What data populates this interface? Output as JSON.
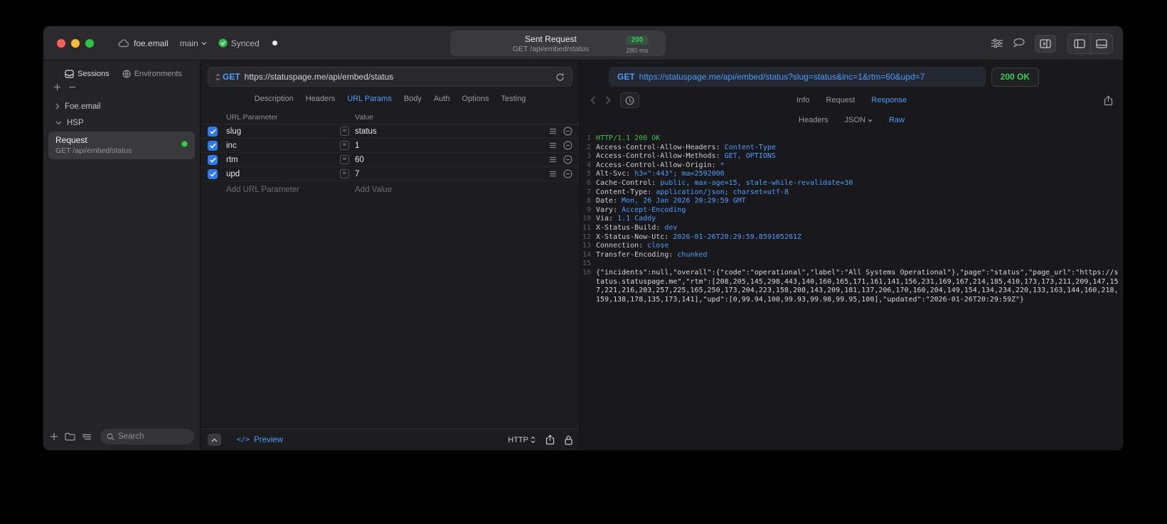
{
  "window": {
    "account": "foe.email",
    "branch": "main",
    "sync_status": "Synced",
    "request_title": "Sent Request",
    "request_subtitle": "GET /api/embed/status",
    "status_code": "200",
    "duration": "280 ms",
    "accent_blue": "#4a9eff",
    "status_green": "#30d158"
  },
  "sidebar": {
    "tabs": [
      {
        "label": "Sessions"
      },
      {
        "label": "Environments"
      }
    ],
    "tree": [
      {
        "label": "Foe.email"
      },
      {
        "label": "HSP"
      }
    ],
    "request_item": {
      "title": "Request",
      "subtitle": "GET /api/embed/status"
    },
    "search_placeholder": "Search"
  },
  "request_panel": {
    "method": "GET",
    "url": "https://statuspage.me/api/embed/status",
    "tabs": [
      "Description",
      "Headers",
      "URL Params",
      "Body",
      "Auth",
      "Options",
      "Testing"
    ],
    "active_tab": "URL Params",
    "table": {
      "col_param": "URL Parameter",
      "col_value": "Value",
      "rows": [
        {
          "name": "slug",
          "value": "status",
          "checked": true
        },
        {
          "name": "inc",
          "value": "1",
          "checked": true
        },
        {
          "name": "rtm",
          "value": "60",
          "checked": true
        },
        {
          "name": "upd",
          "value": "7",
          "checked": true
        }
      ],
      "add_param": "Add URL Parameter",
      "add_value": "Add Value"
    },
    "footer": {
      "preview_label": "Preview",
      "http_label": "HTTP"
    }
  },
  "response_panel": {
    "method": "GET",
    "url": "https://statuspage.me/api/embed/status?slug=status&inc=1&rtm=60&upd=7",
    "status": "200 OK",
    "tabs": [
      "Info",
      "Request",
      "Response"
    ],
    "active_tab": "Response",
    "subtabs": [
      "Headers",
      "JSON",
      "Raw"
    ],
    "active_subtab": "Raw",
    "lines": [
      {
        "n": "1",
        "text": "HTTP/1.1 200 OK"
      },
      {
        "n": "2",
        "name": "Access-Control-Allow-Headers:",
        "value": "Content-Type"
      },
      {
        "n": "3",
        "name": "Access-Control-Allow-Methods:",
        "value": "GET, OPTIONS"
      },
      {
        "n": "4",
        "name": "Access-Control-Allow-Origin:",
        "value": "*"
      },
      {
        "n": "5",
        "name": "Alt-Svc:",
        "value": "h3=\":443\"; ma=2592000"
      },
      {
        "n": "6",
        "name": "Cache-Control:",
        "value": "public, max-age=15, stale-while-revalidate=30"
      },
      {
        "n": "7",
        "name": "Content-Type:",
        "value": "application/json; charset=utf-8"
      },
      {
        "n": "8",
        "name": "Date:",
        "value": "Mon, 26 Jan 2026 20:29:59 GMT"
      },
      {
        "n": "9",
        "name": "Vary:",
        "value": "Accept-Encoding"
      },
      {
        "n": "10",
        "name": "Via:",
        "value": "1.1 Caddy"
      },
      {
        "n": "11",
        "name": "X-Status-Build:",
        "value": "dev"
      },
      {
        "n": "12",
        "name": "X-Status-Now-Utc:",
        "value": "2026-01-26T20:29:59.859105261Z"
      },
      {
        "n": "13",
        "name": "Connection:",
        "value": "close"
      },
      {
        "n": "14",
        "name": "Transfer-Encoding:",
        "value": "chunked"
      },
      {
        "n": "15"
      },
      {
        "n": "16",
        "text": "{\"incidents\":null,\"overall\":{\"code\":\"operational\",\"label\":\"All Systems Operational\"},\"page\":\"status\",\"page_url\":\"https://status.statuspage.me\",\"rtm\":[208,205,145,298,443,140,160,165,171,161,141,156,231,169,167,214,185,410,173,173,211,209,147,157,221,216,203,257,225,165,250,173,204,223,158,208,143,209,181,137,206,170,160,204,149,154,134,234,220,133,163,144,160,218,159,138,178,135,173,141],\"upd\":[0,99.94,100,99.93,99.98,99.95,100],\"updated\":\"2026-01-26T20:29:59Z\"}"
      }
    ]
  }
}
